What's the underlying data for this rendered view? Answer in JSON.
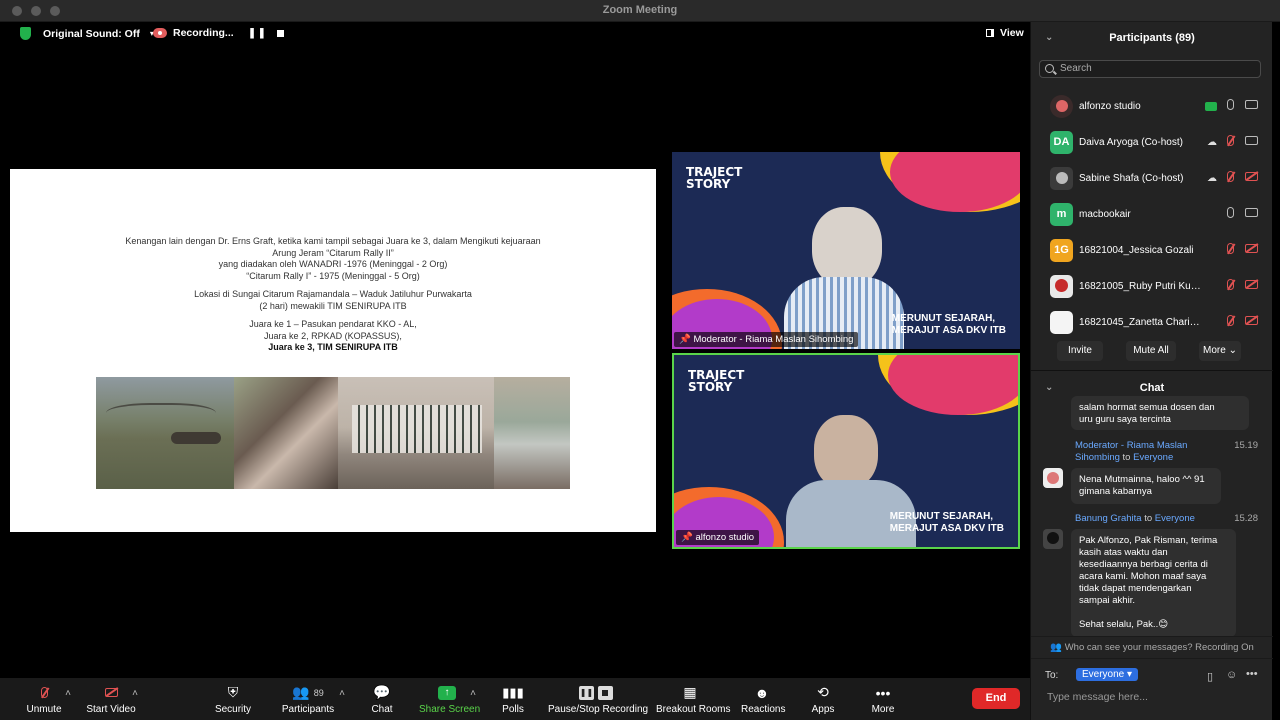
{
  "window": {
    "title": "Zoom Meeting"
  },
  "topbar": {
    "original_sound": "Original Sound: Off",
    "recording": "Recording...",
    "view": "View"
  },
  "slide": {
    "lines": [
      "Kenangan lain dengan Dr. Erns Graft, ketika kami tampil sebagai Juara ke 3, dalam Mengikuti kejuaraan",
      "Arung Jeram “Citarum Rally II”",
      "yang diadakan oleh WANADRI -1976 (Meninggal - 2 Org)",
      "“Citarum Rally I” - 1975 (Meninggal - 5 Org)",
      "Lokasi di Sungai Citarum Rajamandala – Waduk Jatiluhur Purwakarta",
      "(2 hari) mewakili  TIM SENIRUPA ITB",
      "Juara ke 1 – Pasukan pendarat KKO - AL,",
      "Juara ke 2, RPKAD (KOPASSUS),",
      "Juara ke 3, TIM SENIRUPA ITB"
    ]
  },
  "tiles": [
    {
      "name": "Moderator - Riama Maslan Sihombing",
      "brand_line1": "TRAJECT",
      "brand_line2": "STORY",
      "caption_line1": "MERUNUT SEJARAH,",
      "caption_line2": "MERAJUT ASA DKV ITB"
    },
    {
      "name": "alfonzo studio",
      "brand_line1": "TRAJECT",
      "brand_line2": "STORY",
      "caption_line1": "MERUNUT SEJARAH,",
      "caption_line2": "MERAJUT ASA DKV ITB"
    }
  ],
  "toolbar": {
    "unmute": "Unmute",
    "start_video": "Start Video",
    "security": "Security",
    "participants": "Participants",
    "participants_count": "89",
    "chat": "Chat",
    "share_screen": "Share Screen",
    "polls": "Polls",
    "pause_stop": "Pause/Stop Recording",
    "breakout": "Breakout Rooms",
    "reactions": "Reactions",
    "apps": "Apps",
    "more": "More",
    "end": "End"
  },
  "participants": {
    "title": "Participants (89)",
    "search_placeholder": "Search",
    "list": [
      {
        "name": "alfonzo studio",
        "initials": "",
        "color": "#3a2a2a"
      },
      {
        "name": "Daiva Aryoga (Co-host)",
        "initials": "DA",
        "color": "#2fb36b"
      },
      {
        "name": "Sabine Shafa (Co-host)",
        "initials": "",
        "color": "#3b3b3b"
      },
      {
        "name": "macbookair",
        "initials": "m",
        "color": "#2fb36b"
      },
      {
        "name": "16821004_Jessica Gozali",
        "initials": "1G",
        "color": "#f0a51f"
      },
      {
        "name": "16821005_Ruby Putri Kurnia...",
        "initials": "",
        "color": "#e8e8e8"
      },
      {
        "name": "16821045_Zanetta Charissa...",
        "initials": "",
        "color": "#f4f4f4"
      }
    ],
    "invite": "Invite",
    "mute_all": "Mute All",
    "more": "More"
  },
  "chat": {
    "title": "Chat",
    "messages": {
      "m0_text_1": "salam hormat semua dosen dan",
      "m0_text_2": "uru guru saya tercinta",
      "m1_sender_1": "Moderator - Riama Maslan",
      "m1_sender_2": "Sihombing",
      "m1_to": "to",
      "m1_everyone": "Everyone",
      "m1_time": "15.19",
      "m1_text_1": "Nena Mutmainna, haloo ^^ 91",
      "m1_text_2": "gimana kabarnya",
      "m2_sender": "Banung Grahita",
      "m2_to": "to",
      "m2_everyone": "Everyone",
      "m2_time": "15.28",
      "m2_lines": [
        "Pak Alfonzo, Pak Risman, terima",
        "kasih atas waktu dan",
        "kesediaannya berbagi cerita di",
        "acara kami. Mohon maaf saya",
        "tidak dapat mendengarkan",
        "sampai akhir."
      ],
      "m2_signoff": "Sehat selalu, Pak..😊"
    },
    "who_can_see": "Who can see your messages? Recording On",
    "to_label": "To:",
    "to_value": "Everyone",
    "placeholder": "Type message here..."
  }
}
